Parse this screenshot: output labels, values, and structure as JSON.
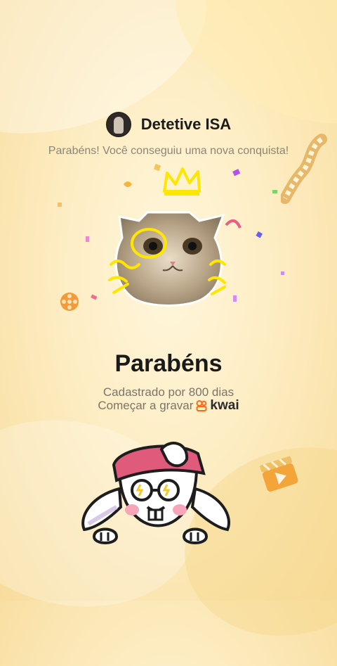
{
  "header": {
    "username": "Detetive ISA",
    "avatar_icon": "profile-photo-avatar"
  },
  "subtitle": "Parabéns! Você conseguiu uma nova conquista!",
  "achievement": {
    "title": "Parabéns",
    "detail_line1": "Cadastrado por 800 dias",
    "detail_line2": "Começar a gravar",
    "brand_text": "kwai"
  },
  "icons": {
    "brand_logo": "kwai-logo-icon",
    "mascot": "kwai-bunny-mascot",
    "film_reel": "film-reel-icon",
    "clapper": "clapperboard-icon",
    "film_strip": "film-strip-icon",
    "crown": "crown-doodle-icon"
  },
  "colors": {
    "background": "#fdedc3",
    "brand_orange": "#ff6a1a",
    "doodle_yellow": "#ffe600"
  }
}
